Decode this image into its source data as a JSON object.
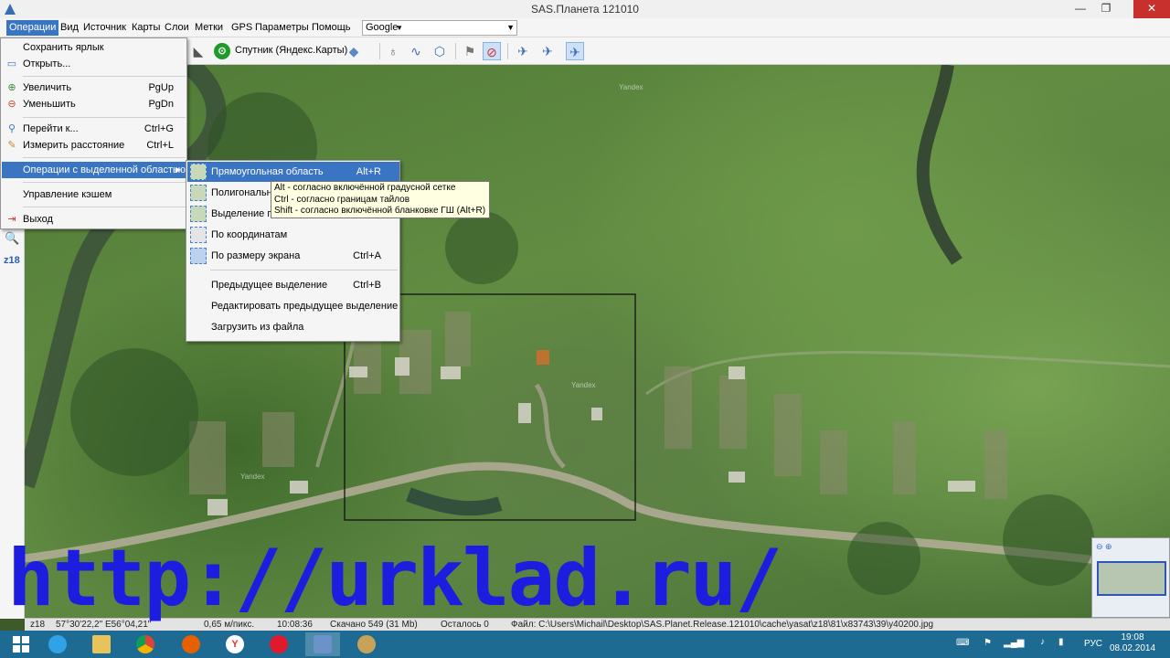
{
  "window": {
    "title": "SAS.Планета 121010",
    "minimize": "—",
    "maximize": "❐",
    "close": "✕"
  },
  "menubar": {
    "items": [
      "Операции",
      "Вид",
      "Источник",
      "Карты",
      "Слои",
      "Метки",
      "GPS",
      "Параметры",
      "Помощь"
    ],
    "active": "Операции",
    "source_combo": "Google"
  },
  "toolbar": {
    "map_label": "Спутник (Яндекс.Карты)"
  },
  "sidebar": {
    "zoom_level": "z18"
  },
  "main_menu": {
    "items": [
      {
        "label": "Сохранить ярлык",
        "shortcut": ""
      },
      {
        "label": "Открыть...",
        "shortcut": ""
      },
      {
        "label": "Увеличить",
        "shortcut": "PgUp"
      },
      {
        "label": "Уменьшить",
        "shortcut": "PgDn"
      },
      {
        "label": "Перейти к...",
        "shortcut": "Ctrl+G"
      },
      {
        "label": "Измерить расстояние",
        "shortcut": "Ctrl+L"
      },
      {
        "label": "Операции с выделенной областью",
        "shortcut": ""
      },
      {
        "label": "Управление кэшем",
        "shortcut": ""
      },
      {
        "label": "Выход",
        "shortcut": ""
      }
    ]
  },
  "submenu": {
    "items": [
      {
        "label": "Прямоугольная область",
        "shortcut": "Alt+R"
      },
      {
        "label": "Полигональна",
        "shortcut": ""
      },
      {
        "label": "Выделение по",
        "shortcut": ""
      },
      {
        "label": "По координатам",
        "shortcut": ""
      },
      {
        "label": "По размеру экрана",
        "shortcut": "Ctrl+A"
      },
      {
        "label": "Предыдущее выделение",
        "shortcut": "Ctrl+B"
      },
      {
        "label": "Редактировать предыдущее выделение",
        "shortcut": ""
      },
      {
        "label": "Загрузить из файла",
        "shortcut": ""
      }
    ]
  },
  "tooltip": {
    "lines": [
      "Alt - согласно включённой градусной сетке",
      "Ctrl - согласно границам тайлов",
      "Shift - согласно включённой бланковке ГШ (Alt+R)"
    ]
  },
  "map": {
    "watermark": "Yandex"
  },
  "statusbar": {
    "zoom": "z18",
    "coords": "57°30'22,2\"  E56°04,21\"",
    "scale": "0,65 м/пикс.",
    "time": "10:08:36",
    "downloaded": "Скачано 549 (31 Mb)",
    "remaining": "Осталось 0",
    "file": "Файл: C:\\Users\\Michail\\Desktop\\SAS.Planet.Release.121010\\cache\\yasat\\z18\\81\\x83743\\39\\y40200.jpg"
  },
  "overlay_text": "http://urklad.ru/",
  "taskbar": {
    "lang": "РУС",
    "time": "19:08",
    "date": "08.02.2014"
  },
  "colors": {
    "menu_highlight": "#3a75c4",
    "close_button": "#c7302d",
    "taskbar": "#1d6a93",
    "overlay_text": "#1d1de0"
  }
}
